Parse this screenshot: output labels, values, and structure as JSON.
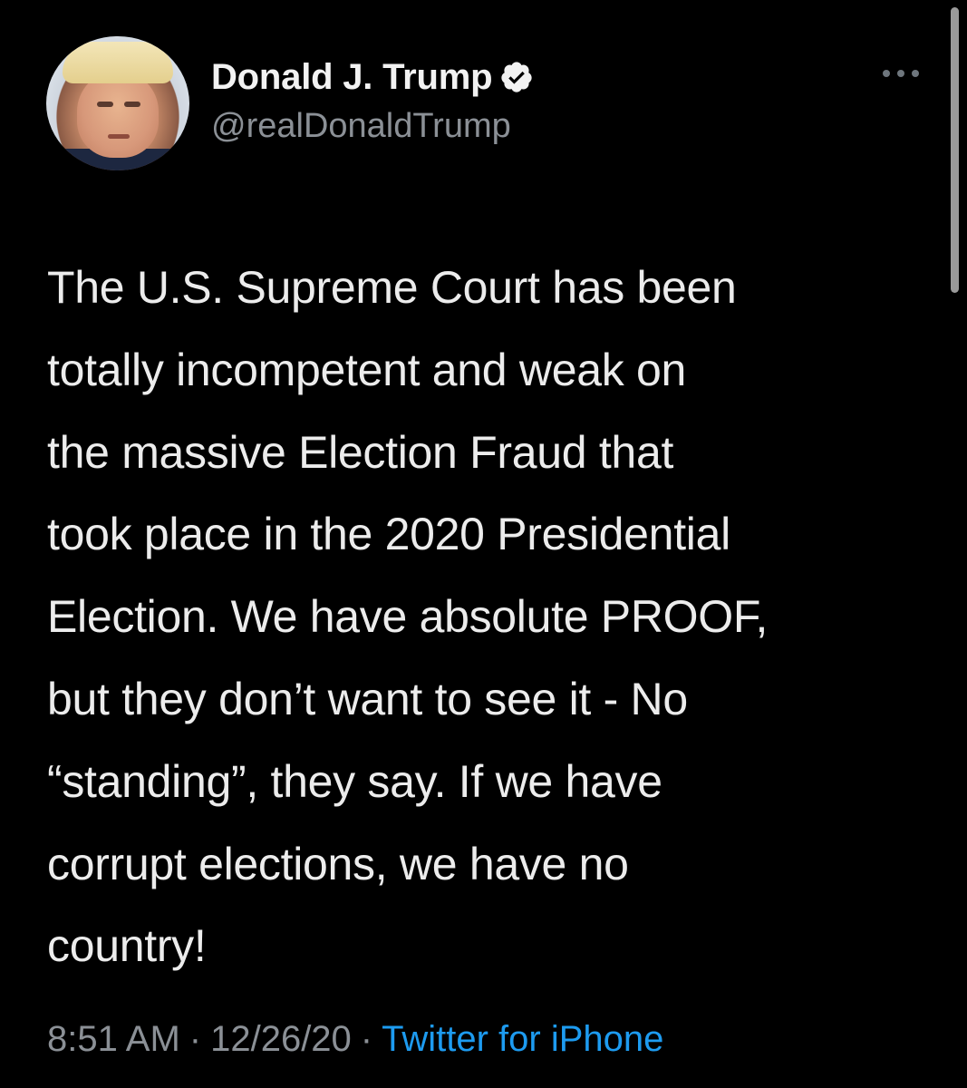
{
  "author": {
    "display_name": "Donald J. Trump",
    "handle": "@realDonaldTrump",
    "verified": true
  },
  "tweet": {
    "lines": [
      "The U.S. Supreme Court has been",
      "totally incompetent and weak on",
      "the massive Election Fraud that",
      "took place in the 2020 Presidential",
      "Election. We have absolute PROOF,",
      "but they don’t want to see it - No",
      "“standing”, they say. If we have",
      "corrupt elections, we have no",
      "country!"
    ]
  },
  "meta": {
    "time": "8:51 AM",
    "separator": "·",
    "date": "12/26/20",
    "source": "Twitter for iPhone"
  },
  "icons": {
    "more": "more-options-icon",
    "verified": "verified-badge-icon"
  },
  "colors": {
    "background": "#000000",
    "text": "#ececec",
    "secondary": "#8b9096",
    "link": "#1d9bf0"
  }
}
